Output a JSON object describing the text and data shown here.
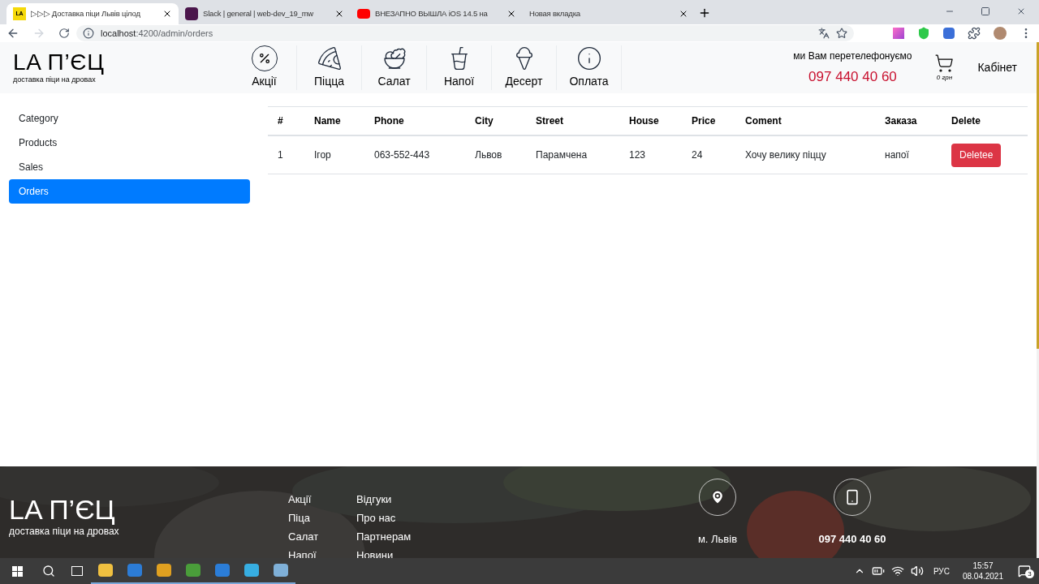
{
  "browser": {
    "tabs": [
      {
        "title": "▷▷▷ Доставка піци Львів цілод",
        "favicon": "LA",
        "kind": "site",
        "selected": true
      },
      {
        "title": "Slack | general | web-dev_19_mw",
        "kind": "slack",
        "selected": false
      },
      {
        "title": "ВНЕЗАПНО ВЫШЛА iOS 14.5 на",
        "kind": "youtube",
        "selected": false
      },
      {
        "title": "Новая вкладка",
        "kind": "none",
        "selected": false
      }
    ],
    "url_host": "localhost",
    "url_path": ":4200/admin/orders"
  },
  "header": {
    "logo": "LA П’ЄЦ",
    "tagline": "доставка піци на дровах",
    "nav": [
      {
        "label": "Акції",
        "kind": "percent"
      },
      {
        "label": "Піцца",
        "kind": "pizza"
      },
      {
        "label": "Салат",
        "kind": "salad"
      },
      {
        "label": "Напої",
        "kind": "drink"
      },
      {
        "label": "Десерт",
        "kind": "dessert"
      },
      {
        "label": "Оплата",
        "kind": "info"
      }
    ],
    "callback": "ми Вам перетелефонуємо",
    "phone": "097 440 40 60",
    "cart_total": "0 грн",
    "cabinet": "Кабінет"
  },
  "sidebar": [
    {
      "label": "Category",
      "selected": false
    },
    {
      "label": "Products",
      "selected": false
    },
    {
      "label": "Sales",
      "selected": false
    },
    {
      "label": "Orders",
      "selected": true
    }
  ],
  "table": {
    "columns": [
      "#",
      "Name",
      "Phone",
      "City",
      "Street",
      "House",
      "Price",
      "Coment",
      "Заказа",
      "Delete"
    ],
    "rows": [
      {
        "cells": [
          "1",
          "Ігор",
          "063-552-443",
          "Львов",
          "Парамчена",
          "123",
          "24",
          "Хочу велику піццу",
          "напої"
        ],
        "action": "Deletee"
      }
    ]
  },
  "footer": {
    "logo": "LA П’ЄЦ",
    "tagline": "доставка піци на дровах",
    "links_1": [
      "Акції",
      "Піца",
      "Салат",
      "Напої"
    ],
    "links_2": [
      "Відгуки",
      "Про нас",
      "Партнерам",
      "Новини"
    ],
    "city": "м. Львів",
    "phone": "097 440 40 60"
  },
  "taskbar": {
    "lang": "РУС",
    "time": "15:57",
    "date": "08.04.2021",
    "notifications": "3"
  }
}
